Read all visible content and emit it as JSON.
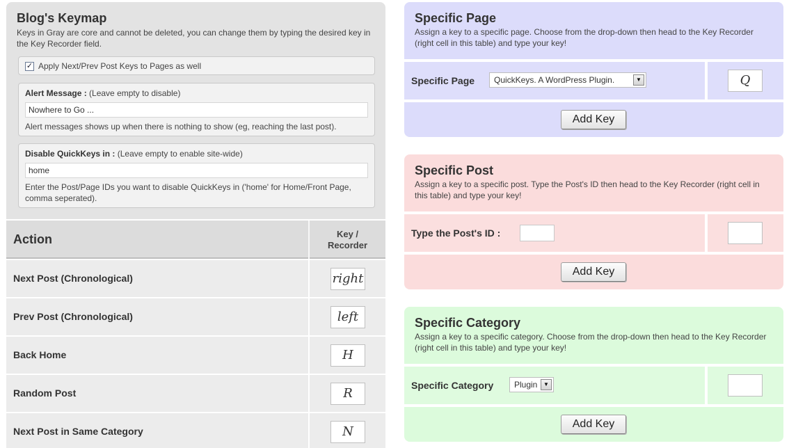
{
  "blog_keymap": {
    "title": "Blog's Keymap",
    "description": "Keys in Gray are core and cannot be deleted, you can change them by typing the desired key in the Key Recorder field.",
    "apply_checkbox": {
      "checked": true,
      "label": "Apply Next/Prev Post Keys to Pages as well"
    },
    "alert": {
      "label_bold": "Alert Message :",
      "label_rest": " (Leave empty to disable)",
      "value": "Nowhere to Go ...",
      "help": "Alert messages shows up when there is nothing to show (eg, reaching the last post)."
    },
    "disable": {
      "label_bold": "Disable QuickKeys in :",
      "label_rest": " (Leave empty to enable site-wide)",
      "value": "home",
      "help": "Enter the Post/Page IDs you want to disable QuickKeys in ('home' for Home/Front Page, comma seperated)."
    }
  },
  "action_table": {
    "header_action": "Action",
    "header_key_line1": "Key /",
    "header_key_line2": "Recorder",
    "rows": [
      {
        "action": "Next Post (Chronological)",
        "key": "right"
      },
      {
        "action": "Prev Post (Chronological)",
        "key": "left"
      },
      {
        "action": "Back Home",
        "key": "H"
      },
      {
        "action": "Random Post",
        "key": "R"
      },
      {
        "action": "Next Post in Same Category",
        "key": "N"
      }
    ]
  },
  "specific_page": {
    "title": "Specific Page",
    "description": "Assign a key to a specific page. Choose from the drop-down then head to the Key Recorder (right cell in this table) and type your key!",
    "field_label": "Specific Page",
    "selected_option": "QuickKeys. A WordPress Plugin.",
    "key": "Q",
    "button": "Add Key"
  },
  "specific_post": {
    "title": "Specific Post",
    "description": "Assign a key to a specific post. Type the Post's ID then head to the Key Recorder (right cell in this table) and type your key!",
    "field_label": "Type the Post's ID :",
    "post_id_value": "",
    "key": "",
    "button": "Add Key"
  },
  "specific_category": {
    "title": "Specific Category",
    "description": "Assign a key to a specific category. Choose from the drop-down then head to the Key Recorder (right cell in this table) and type your key!",
    "field_label": "Specific Category",
    "selected_option": "Plugin",
    "key": "",
    "button": "Add Key"
  },
  "icons": {
    "checkbox_check": "check-icon",
    "dropdown_arrow": "chevron-down-icon"
  },
  "colors": {
    "page_card": "#dcdcfb",
    "post_card": "#fbdcdc",
    "category_card": "#dcfbdc",
    "keymap_panel": "#e3e3e3"
  }
}
